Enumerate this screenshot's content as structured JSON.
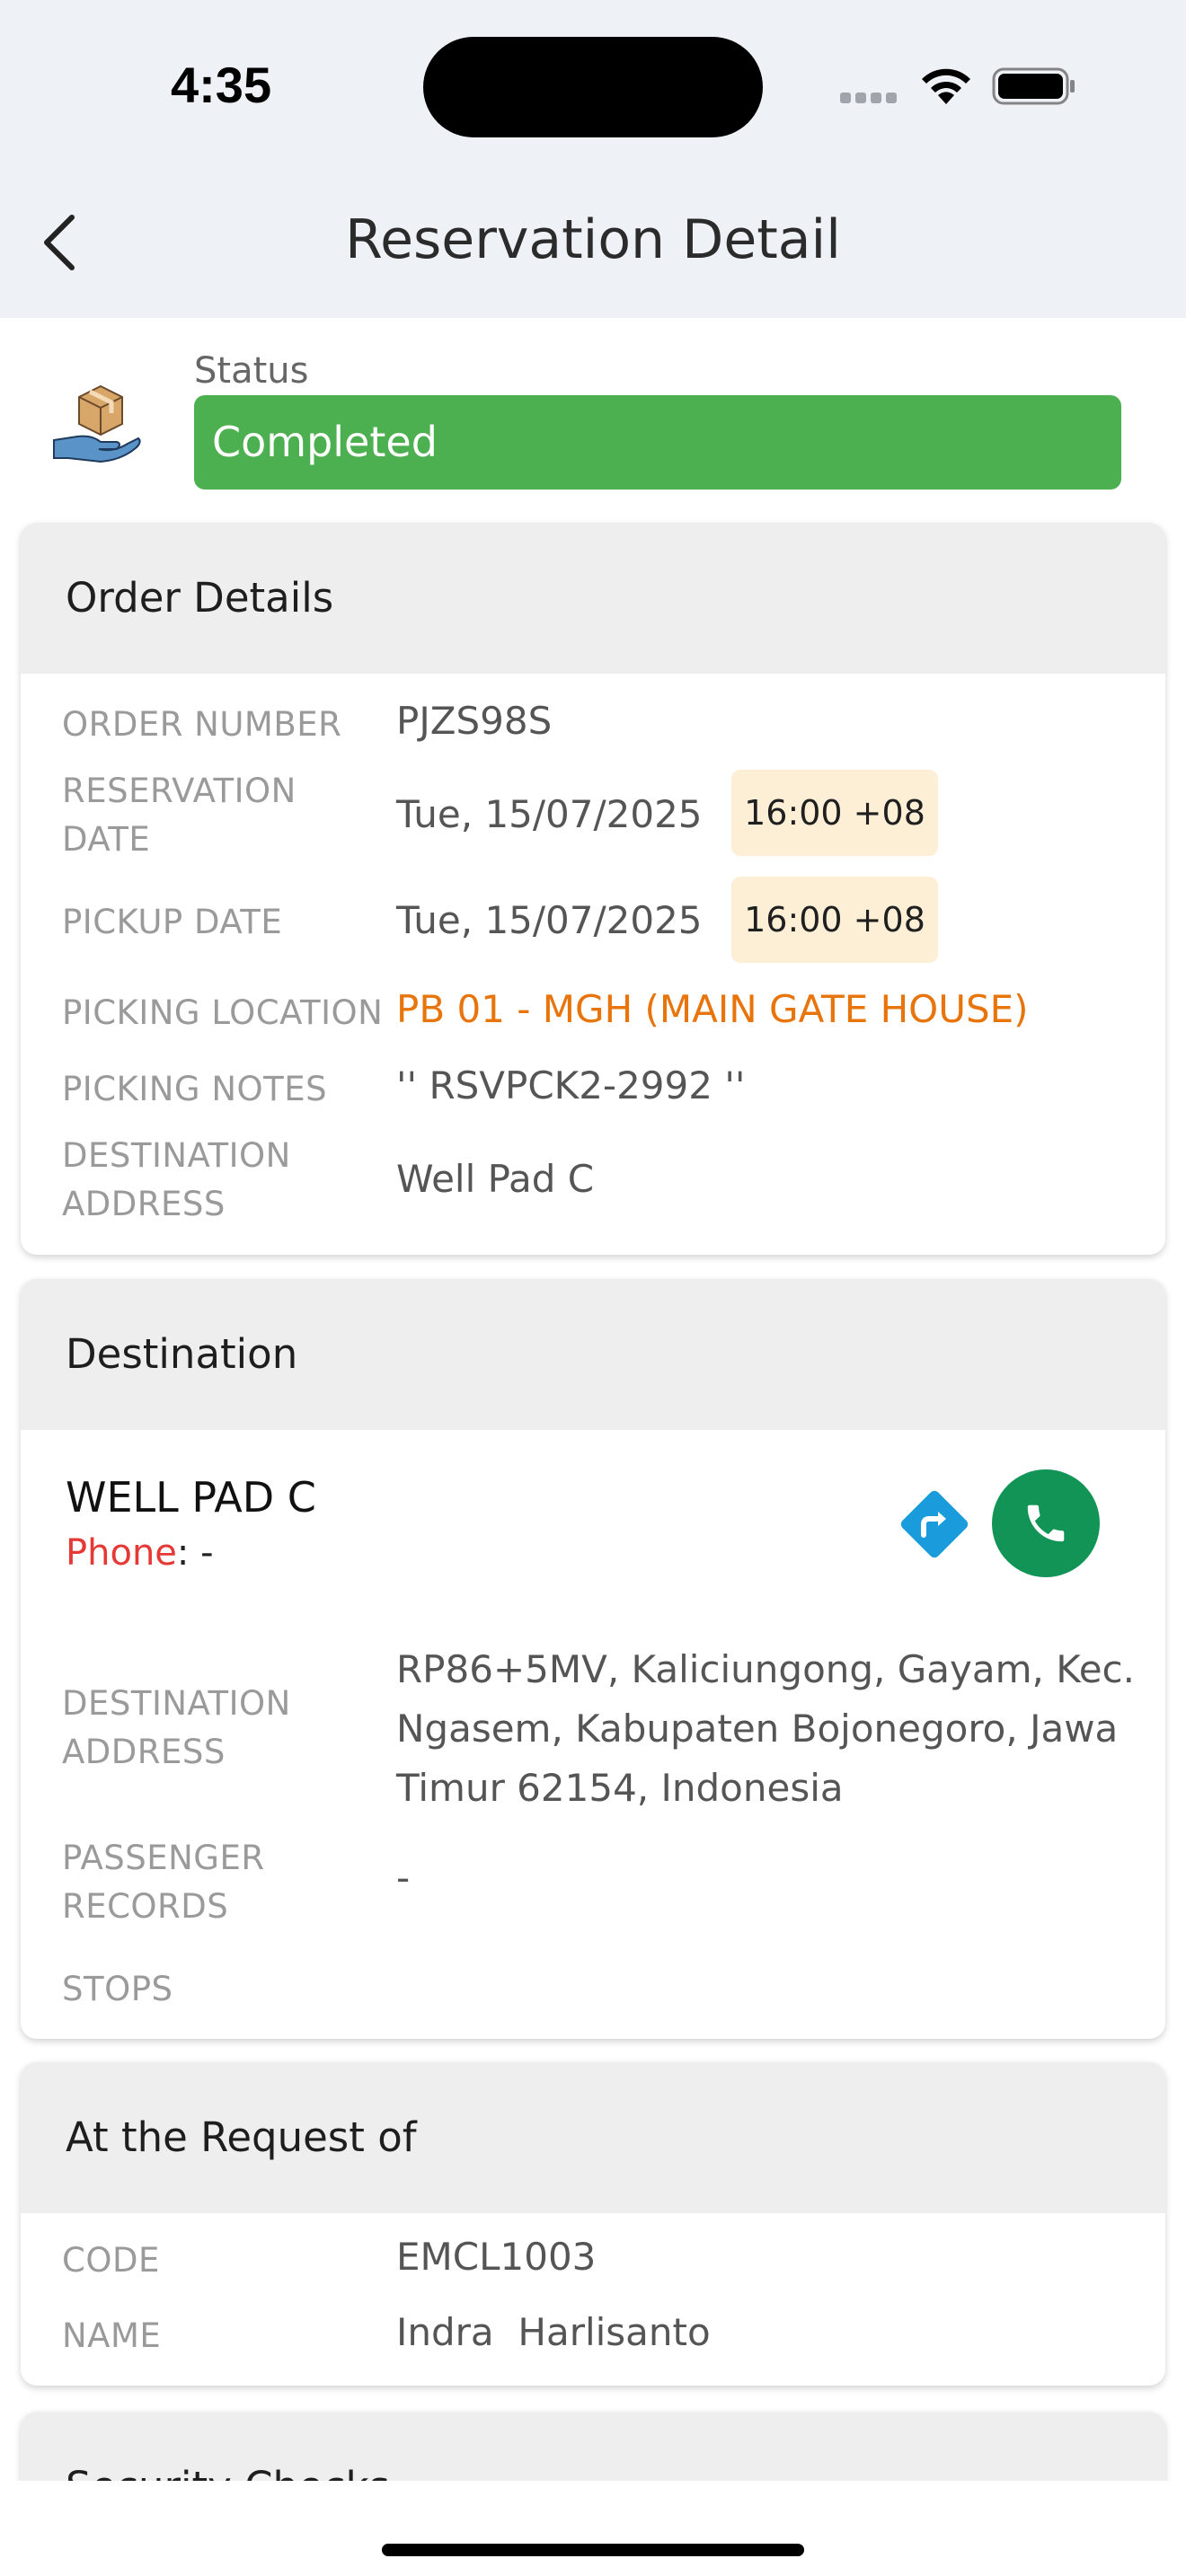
{
  "status_bar": {
    "time": "4:35"
  },
  "nav": {
    "title": "Reservation Detail",
    "back_icon": "chevron-left-icon"
  },
  "status": {
    "label": "Status",
    "value": "Completed",
    "color": "#4caf50",
    "icon": "package-hand-icon"
  },
  "order_details": {
    "header": "Order Details",
    "rows": [
      {
        "label": "ORDER NUMBER",
        "value": "PJZS98S"
      },
      {
        "label": "RESERVATION DATE",
        "value": "Tue, 15/07/2025",
        "time": "16:00 +08"
      },
      {
        "label": "PICKUP DATE",
        "value": "Tue, 15/07/2025",
        "time": "16:00 +08"
      },
      {
        "label": "PICKING LOCATION",
        "value": "PB 01 - MGH (MAIN GATE HOUSE)"
      },
      {
        "label": "PICKING NOTES",
        "value": "'' RSVPCK2-2992 ''"
      },
      {
        "label": "DESTINATION ADDRESS",
        "value": "Well Pad C"
      }
    ]
  },
  "destination": {
    "header": "Destination",
    "name": "WELL PAD C",
    "phone_label": "Phone",
    "phone_value": ": -",
    "rows": [
      {
        "label": "DESTINATION ADDRESS",
        "value": "RP86+5MV, Kaliciungong, Gayam, Kec. Ngasem, Kabupaten Bojonegoro, Jawa Timur 62154, Indonesia"
      },
      {
        "label": "PASSENGER RECORDS",
        "value": "-"
      },
      {
        "label": "STOPS",
        "value": ""
      }
    ]
  },
  "requester": {
    "header": "At the Request of",
    "rows": [
      {
        "label": "CODE",
        "value": "EMCL1003"
      },
      {
        "label": "NAME",
        "value": "Indra  Harlisanto"
      }
    ]
  },
  "security": {
    "header": "Security Checks"
  },
  "colors": {
    "accent_orange": "#e8740c",
    "call_green": "#129456",
    "directions_blue": "#1a9bdc",
    "phone_red": "#e53935"
  }
}
